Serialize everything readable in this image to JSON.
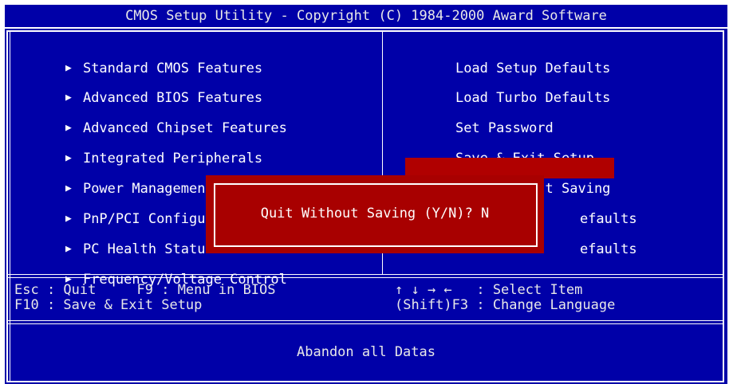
{
  "title": "CMOS Setup Utility - Copyright (C) 1984-2000 Award Software",
  "left_menu": [
    {
      "label": "Standard CMOS Features"
    },
    {
      "label": "Advanced BIOS Features"
    },
    {
      "label": "Advanced Chipset Features"
    },
    {
      "label": "Integrated Peripherals"
    },
    {
      "label": "Power Management Setup"
    },
    {
      "label": "PnP/PCI Configura"
    },
    {
      "label": "PC Health Status"
    },
    {
      "label": "Frequency/Voltage Control"
    }
  ],
  "right_menu": [
    {
      "label": "Load Setup Defaults"
    },
    {
      "label": "Load Turbo Defaults"
    },
    {
      "label": "Set Password"
    },
    {
      "label": "Save & Exit Setup"
    },
    {
      "label": "Exit Without Saving",
      "selected": true
    },
    {
      "label": "efaults"
    },
    {
      "label": "efaults"
    }
  ],
  "dialog": {
    "text": "Quit Without Saving (Y/N)? N"
  },
  "footer": {
    "line1_left": "Esc : Quit     F9 : Menu in BIOS",
    "line2_left": "F10 : Save & Exit Setup",
    "line1_right": "↑ ↓ → ←   : Select Item",
    "line2_right": "(Shift)F3 : Change Language"
  },
  "status": "Abandon all Datas",
  "colors": {
    "background": "#0000a8",
    "highlight": "#b00000",
    "text": "#ffffff"
  },
  "icons": {
    "menu_arrow": "right-triangle-icon"
  }
}
